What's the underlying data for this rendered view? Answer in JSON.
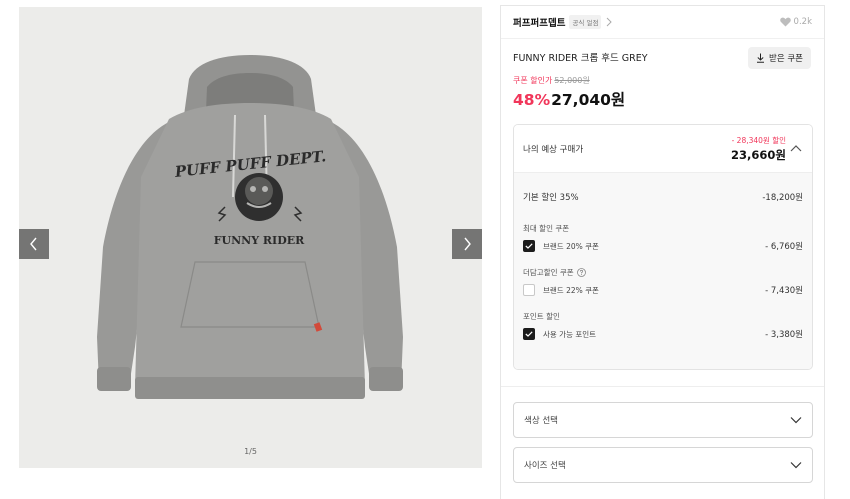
{
  "gallery": {
    "counter": "1/5",
    "print_text_1": "PUFF PUFF DEPT.",
    "print_text_2": "FUNNY RIDER",
    "icons": {
      "prev": "chevron-left-icon",
      "next": "chevron-right-icon"
    }
  },
  "brand": {
    "name": "퍼프퍼프뎁트",
    "official_badge": "공식 얼점",
    "likes": "0.2k",
    "icons": {
      "chevron": "chevron-right-icon",
      "like": "heart-icon"
    }
  },
  "product": {
    "name": "FUNNY RIDER 크롭 후드 GREY"
  },
  "price": {
    "coupon_label": "쿠폰 할인가",
    "original": "52,000원",
    "discount_pct": "48%",
    "sale_price": "27,040원",
    "coupon_button": "받은 쿠폰",
    "accent_color": "#f1365a"
  },
  "estimate": {
    "label": "나의 예상 구매가",
    "discount_total": "- 28,340원 할인",
    "price": "23,660원",
    "basic_label": "기본 할인 35%",
    "basic_amount": "-18,200원",
    "max_coupon_title": "최대 할인 쿠폰",
    "brand_coupon_label": "브랜드 20% 쿠폰",
    "brand_coupon_amount": "- 6,760원",
    "brand_coupon_checked": true,
    "more_coupon_title": "더담고할인 쿠폰",
    "more_coupon_label": "브랜드 22% 쿠폰",
    "more_coupon_amount": "- 7,430원",
    "more_coupon_checked": false,
    "point_title": "포인트 할인",
    "point_label": "사용 가능 포인트",
    "point_amount": "- 3,380원",
    "point_checked": true
  },
  "options": {
    "color_placeholder": "색상 선택",
    "size_placeholder": "사이즈 선택"
  }
}
